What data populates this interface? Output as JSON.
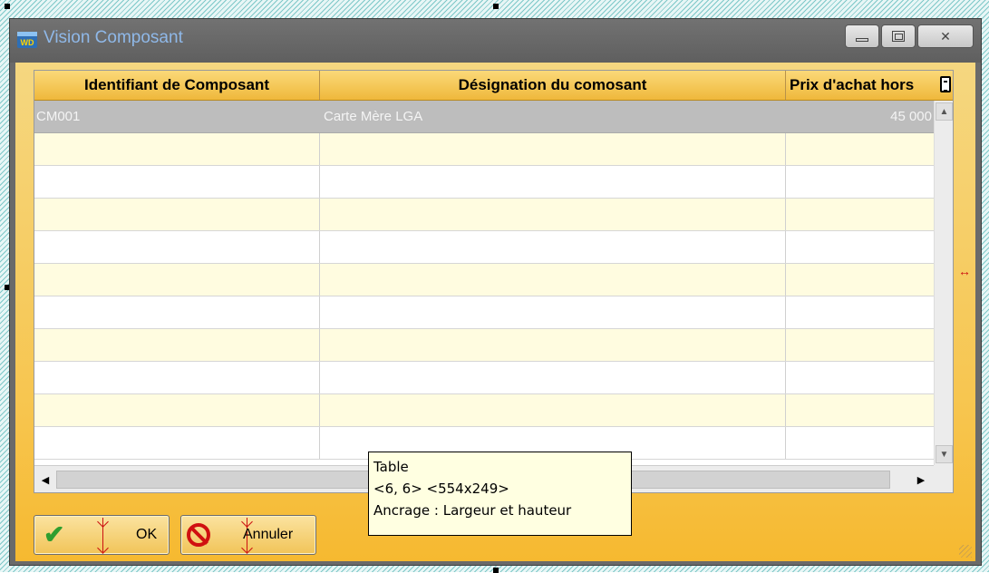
{
  "window": {
    "title": "Vision Composant",
    "app_icon_text": "WD",
    "controls": [
      "minimize",
      "maximize",
      "close"
    ]
  },
  "table": {
    "columns": [
      "Identifiant de Composant",
      "Désignation du comosant",
      "Prix d'achat hors"
    ],
    "rows": [
      {
        "id": "CM001",
        "designation": "Carte Mère LGA",
        "price": "45 000"
      }
    ],
    "selected_row_index": 0,
    "empty_row_count": 10
  },
  "tooltip": {
    "line1": "Table",
    "line2": "<6, 6>  <554x249>",
    "line3": "Ancrage : Largeur et hauteur"
  },
  "buttons": {
    "ok_label": "OK",
    "cancel_label": "Annuler"
  },
  "icons": {
    "scroll_up": "scroll-up-arrow-icon",
    "scroll_down": "scroll-down-arrow-icon",
    "scroll_left": "scroll-left-arrow-icon",
    "scroll_right": "scroll-right-arrow-icon",
    "column_menu": "column-menu-icon",
    "ok": "checkmark-icon",
    "cancel": "stop-icon"
  },
  "colors": {
    "title_text": "#8fb8e8",
    "header_bg": "#f3c54f",
    "selected_row": "#bdbdbd",
    "alt_row": "#fffce0",
    "anchor_marker": "#cc1111"
  }
}
